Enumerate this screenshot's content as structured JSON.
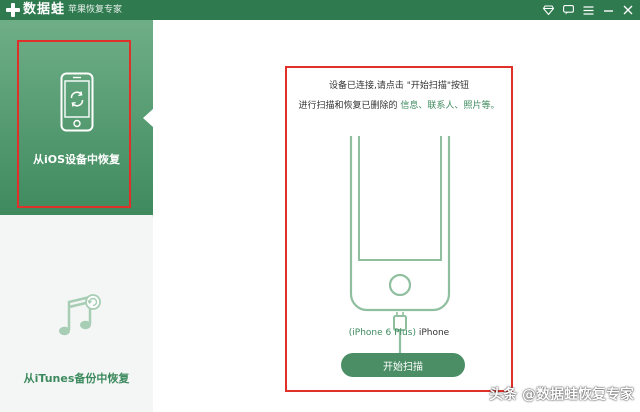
{
  "titlebar": {
    "app_name": "数据蛙",
    "subtitle": "苹果恢复专家",
    "controls": [
      "diamond-icon",
      "chat-icon",
      "menu-icon",
      "minimize-icon",
      "close-icon"
    ]
  },
  "sidebar": {
    "items": [
      {
        "label": "从iOS设备中恢复",
        "icon": "phone-restore-icon",
        "active": true
      },
      {
        "label": "从iTunes备份中恢复",
        "icon": "music-restore-icon",
        "active": false
      }
    ]
  },
  "main": {
    "instruction_line1": "设备已连接,请点击 \"开始扫描\"按钮",
    "instruction_line2_prefix": "进行扫描和恢复已删除的 ",
    "instruction_links": [
      "信息、",
      "联系人、",
      "照片等。"
    ],
    "device_model": "(iPhone 6 Plus)",
    "device_suffix": " iPhone",
    "scan_button_label": "开始扫描"
  },
  "watermark": "头条 @数据蛙恢复专家",
  "colors": {
    "titlebar": "#2f7a4f",
    "accent_green": "#3d8a5e",
    "button_green": "#4b8e66",
    "highlight_red": "#e0302a"
  }
}
